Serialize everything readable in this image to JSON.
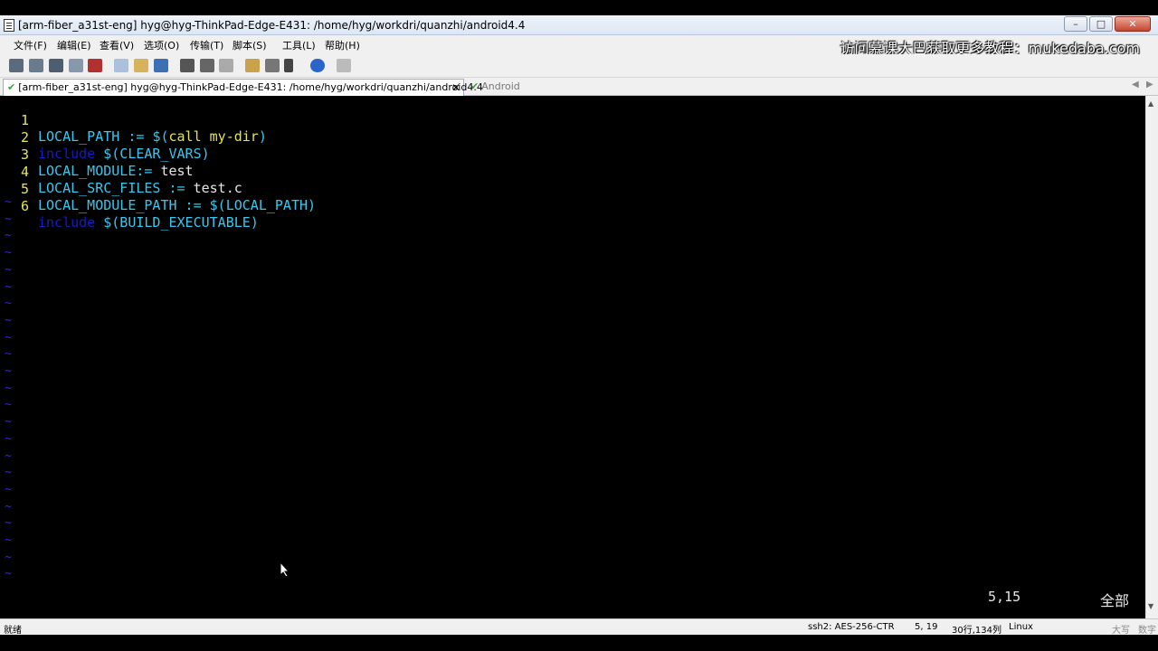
{
  "window": {
    "title": "[arm-fiber_a31st-eng] hyg@hyg-ThinkPad-Edge-E431: /home/hyg/workdri/quanzhi/android4.4"
  },
  "menu": {
    "items": [
      "文件(F)",
      "编辑(E)",
      "查看(V)",
      "选项(O)",
      "传输(T)",
      "脚本(S)",
      "工具(L)",
      "帮助(H)"
    ],
    "watermark": "访问慕课大巴获取更多教程：mukedaba.com"
  },
  "tabs": {
    "active": "[arm-fiber_a31st-eng] hyg@hyg-ThinkPad-Edge-E431: /home/hyg/workdri/quanzhi/android4.4",
    "inactive": "Android"
  },
  "editor": {
    "lines": [
      {
        "num": "1",
        "a": "LOCAL_PATH := ",
        "b": "$(",
        "c": "call my-dir",
        "d": ")"
      },
      {
        "num": "2",
        "kw": "include",
        "rest": " $(CLEAR_VARS)"
      },
      {
        "num": "3",
        "a": "LOCAL_MODULE:= ",
        "plain": "test"
      },
      {
        "num": "4",
        "a": "LOCAL_SRC_FILES := ",
        "plain": "test.c"
      },
      {
        "num": "5",
        "a": "LOCAL_MODULE_PATH := $(LOCAL_PATH)"
      },
      {
        "num": "6",
        "kw": "include",
        "rest": " $(BUILD_EXECUTABLE)"
      }
    ],
    "tilde": "~",
    "ruler_position": "5,15",
    "ruler_scope": "全部"
  },
  "status": {
    "ready": "就绪",
    "protocol": "ssh2: AES-256-CTR",
    "cursor": "5,  19",
    "size": "30行,134列",
    "os": "Linux",
    "caps": "大写",
    "num": "数字"
  },
  "colors": {
    "variable": "#36c8ef",
    "keyword": "#1818cc",
    "line_number": "#e5e552",
    "tilde": "#2b2bdd",
    "background": "#000000"
  }
}
